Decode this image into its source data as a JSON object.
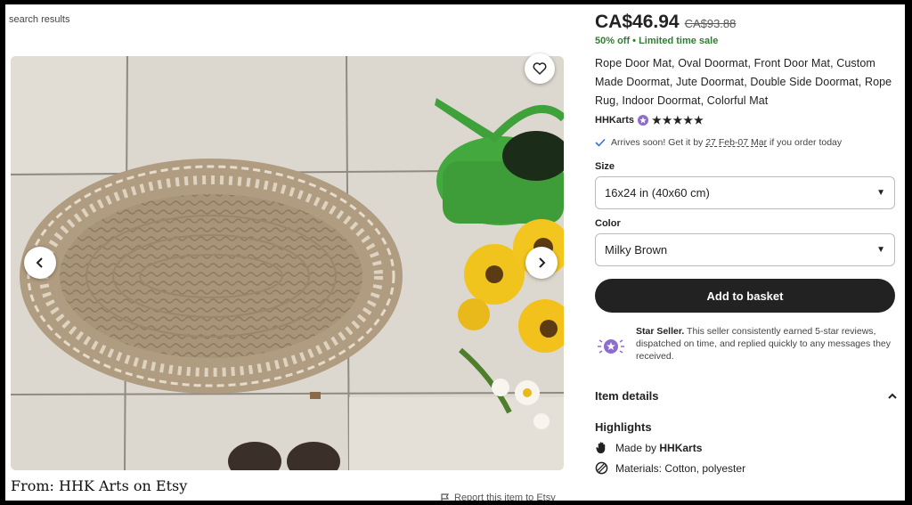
{
  "nav": {
    "back_label": "search results"
  },
  "gallery": {
    "prev_icon": "chevron-left-icon",
    "next_icon": "chevron-right-icon",
    "favorite_icon": "heart-icon"
  },
  "caption": "From: HHK Arts on Etsy",
  "report": {
    "label": "Report this item to Etsy",
    "icon": "flag-icon"
  },
  "product": {
    "price": "CA$46.94",
    "original_price": "CA$93.88",
    "sale_note": "50% off  •  Limited time sale",
    "title": "Rope Door Mat, Oval Doormat, Front Door Mat, Custom Made Doormat, Jute Doormat, Double Side Doormat, Rope Rug, Indoor Doormat, Colorful Mat",
    "seller": "HHKarts",
    "rating_stars": "★★★★★",
    "rating_value": 5
  },
  "delivery": {
    "prefix": "Arrives soon! Get it by ",
    "dates": "27 Feb-07 Mar",
    "suffix": " if you order today"
  },
  "options": {
    "size_label": "Size",
    "size_value": "16x24 in (40x60 cm)",
    "color_label": "Color",
    "color_value": "Milky Brown"
  },
  "add_to_basket": "Add to basket",
  "star_seller": {
    "title": "Star Seller.",
    "text": " This seller consistently earned 5-star reviews, dispatched on time, and replied quickly to any messages they received."
  },
  "item_details": {
    "label": "Item details"
  },
  "highlights": {
    "label": "Highlights",
    "made_by_prefix": "Made by ",
    "made_by_seller": "HHKarts",
    "materials": "Materials: Cotton, polyester"
  },
  "colors": {
    "button_dark": "#222222",
    "sale_green": "#2f7d32",
    "star_seller_purple": "#8e6ccf"
  }
}
